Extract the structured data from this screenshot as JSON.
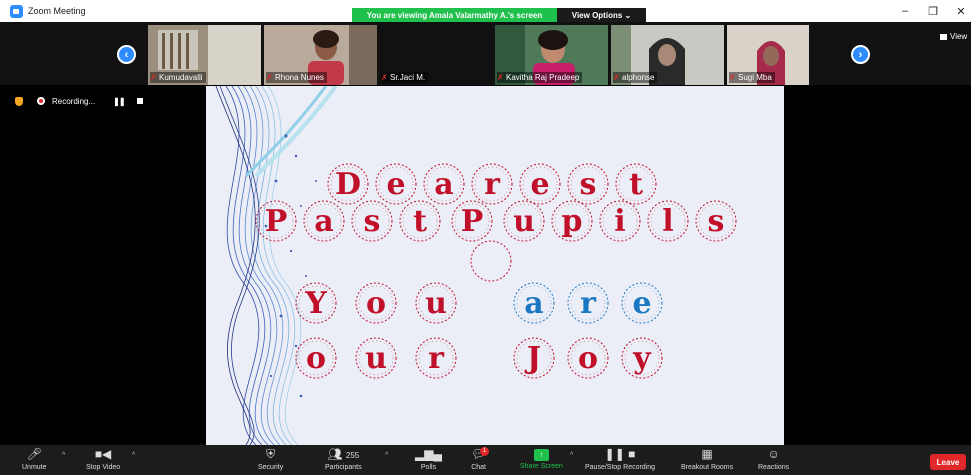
{
  "window": {
    "title": "Zoom Meeting",
    "minimize_icon": "minimize-icon",
    "restore_icon": "restore-icon",
    "close_icon": "close-icon"
  },
  "share_banner": {
    "text": "You are viewing Amala Valarmathy A.'s screen",
    "view_options": "View Options ⌄",
    "color": "#1fc04b"
  },
  "gallery": {
    "participants": [
      {
        "name": "Kumudavalli"
      },
      {
        "name": "Rhona Nunes"
      },
      {
        "name": "Sr.Jaci M."
      },
      {
        "name": "Kavitha Raj Pradeep"
      },
      {
        "name": "alphonse"
      },
      {
        "name": "Sugi Mba"
      }
    ],
    "view_label": "View"
  },
  "recording": {
    "label": "Recording..."
  },
  "slide": {
    "line1": [
      "D",
      "e",
      "a",
      "r",
      "e",
      "s",
      "t"
    ],
    "line2": [
      "P",
      "a",
      "s",
      "t",
      "P",
      "u",
      "p",
      "i",
      "l",
      "s"
    ],
    "line3": [
      "Y",
      "o",
      "u",
      "a",
      "r",
      "e"
    ],
    "line4": [
      "o",
      "u",
      "r",
      "J",
      "o",
      "y"
    ],
    "accent_red": "#c0102a",
    "accent_blue": "#1a78c2"
  },
  "toolbar": {
    "unmute": "Unmute",
    "stop_video": "Stop Video",
    "security": "Security",
    "participants": "Participants",
    "participants_count": "255",
    "polls": "Polls",
    "chat": "Chat",
    "chat_badge": "1",
    "share_screen": "Share Screen",
    "pause_stop_recording": "Pause/Stop Recording",
    "breakout_rooms": "Breakout Rooms",
    "reactions": "Reactions",
    "leave": "Leave"
  }
}
